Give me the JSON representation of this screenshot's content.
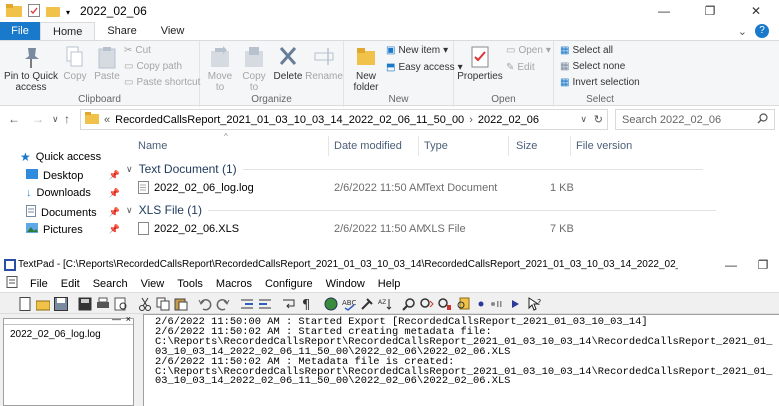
{
  "explorer": {
    "title": "2022_02_06",
    "tabs": [
      "File",
      "Home",
      "Share",
      "View"
    ],
    "active_tab": "Home",
    "ribbon": {
      "clipboard": {
        "label": "Clipboard",
        "pin": "Pin to Quick access",
        "copy": "Copy",
        "paste": "Paste",
        "cut": "Cut",
        "copy_path": "Copy path",
        "paste_shortcut": "Paste shortcut"
      },
      "organize": {
        "label": "Organize",
        "move_to": "Move to",
        "copy_to": "Copy to",
        "delete": "Delete",
        "rename": "Rename"
      },
      "new": {
        "label": "New",
        "new_folder": "New folder",
        "new_item": "New item",
        "easy_access": "Easy access"
      },
      "open": {
        "label": "Open",
        "properties": "Properties",
        "open": "Open",
        "edit": "Edit"
      },
      "select": {
        "label": "Select",
        "select_all": "Select all",
        "select_none": "Select none",
        "invert": "Invert selection"
      }
    },
    "address": {
      "prefix": "«",
      "crumb1": "RecordedCallsReport_2021_01_03_10_03_14_2022_02_06_11_50_00",
      "sep": "›",
      "crumb2": "2022_02_06"
    },
    "search_placeholder": "Search 2022_02_06",
    "nav": [
      "Quick access",
      "Desktop",
      "Downloads",
      "Documents",
      "Pictures"
    ],
    "columns": [
      "Name",
      "Date modified",
      "Type",
      "Size",
      "File version"
    ],
    "groups": [
      {
        "title": "Text Document (1)",
        "files": [
          {
            "name": "2022_02_06_log.log",
            "date": "2/6/2022 11:50 AM",
            "type": "Text Document",
            "size": "1 KB"
          }
        ]
      },
      {
        "title": "XLS File (1)",
        "files": [
          {
            "name": "2022_02_06.XLS",
            "date": "2/6/2022 11:50 AM",
            "type": "XLS File",
            "size": "7 KB"
          }
        ]
      }
    ]
  },
  "textpad": {
    "title": "TextPad - [C:\\Reports\\RecordedCallsReport\\RecordedCallsReport_2021_01_03_10_03_14\\RecordedCallsReport_2021_01_03_10_03_14_2022_02_06_11_50_00\\2022_02_...",
    "menu": [
      "File",
      "Edit",
      "Search",
      "View",
      "Tools",
      "Macros",
      "Configure",
      "Window",
      "Help"
    ],
    "open_file": "2022_02_06_log.log",
    "content": "2/6/2022 11:50:00 AM : Started Export [RecordedCallsReport_2021_01_03_10_03_14]\n2/6/2022 11:50:02 AM : Started creating metadata file:\nC:\\Reports\\RecordedCallsReport\\RecordedCallsReport_2021_01_03_10_03_14\\RecordedCallsReport_2021_01_\n03_10_03_14_2022_02_06_11_50_00\\2022_02_06\\2022_02_06.XLS\n2/6/2022 11:50:02 AM : Metadata file is created:\nC:\\Reports\\RecordedCallsReport\\RecordedCallsReport_2021_01_03_10_03_14\\RecordedCallsReport_2021_01_\n03_10_03_14_2022_02_06_11_50_00\\2022_02_06\\2022_02_06.XLS"
  },
  "colors": {
    "file_tab": "#1979ca",
    "folder": "#f0c24a",
    "header_text": "#4c607a",
    "group_text": "#1e395b"
  }
}
